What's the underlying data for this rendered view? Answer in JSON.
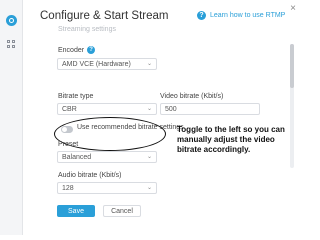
{
  "dialog": {
    "title": "Configure & Start Stream",
    "help_link": "Learn how to use RTMP",
    "close_glyph": "×",
    "clipped_section": "Streaming settings"
  },
  "form": {
    "encoder": {
      "label": "Encoder",
      "help_glyph": "?",
      "value": "AMD VCE (Hardware)"
    },
    "bitrate_type": {
      "label": "Bitrate type",
      "value": "CBR"
    },
    "video_bitrate": {
      "label": "Video bitrate (Kbit/s)",
      "value": "500"
    },
    "recommended_toggle": {
      "label": "Use recommended bitrate settings",
      "state": "off"
    },
    "preset": {
      "label": "Preset",
      "value": "Balanced"
    },
    "audio_bitrate": {
      "label": "Audio bitrate (Kbit/s)",
      "value": "128"
    }
  },
  "buttons": {
    "save": "Save",
    "cancel": "Cancel"
  },
  "annotation": {
    "text": "Toggle to the left so you can manually adjust the video bitrate accordingly."
  },
  "icons": {
    "rail_live": "live-stream-icon",
    "rail_grid": "grid-icon",
    "help": "question-circle-icon",
    "chevron": "chevron-down-icon",
    "close": "close-icon"
  },
  "colors": {
    "accent": "#2a9fd8",
    "border": "#d9dce1"
  }
}
